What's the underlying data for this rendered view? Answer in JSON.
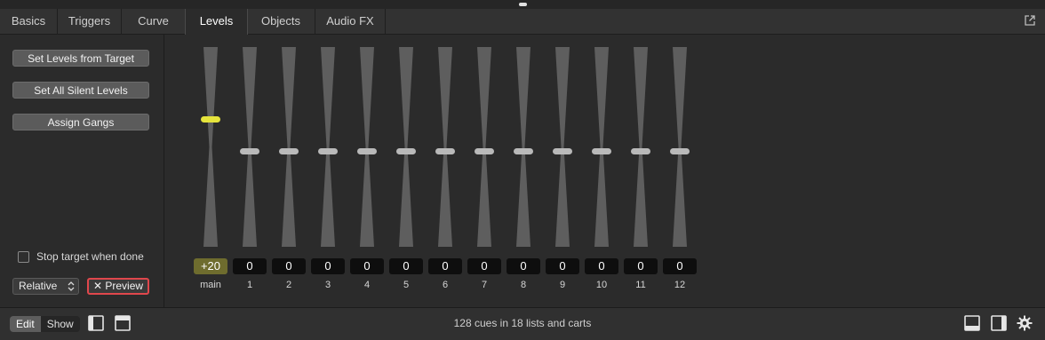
{
  "tabs": [
    {
      "label": "Basics",
      "active": false
    },
    {
      "label": "Triggers",
      "active": false
    },
    {
      "label": "Curve",
      "active": false
    },
    {
      "label": "Levels",
      "active": true
    },
    {
      "label": "Objects",
      "active": false
    },
    {
      "label": "Audio FX",
      "active": false
    }
  ],
  "left_panel": {
    "set_from_target": "Set Levels from Target",
    "set_silent": "Set All Silent Levels",
    "assign_gangs": "Assign Gangs",
    "stop_target_label": "Stop target when done",
    "stop_target_checked": false,
    "mode_select": "Relative",
    "preview_label": "Preview"
  },
  "faders": [
    {
      "label": "main",
      "value": "+20",
      "level": 0.36
    },
    {
      "label": "1",
      "value": "0",
      "level": 0.52
    },
    {
      "label": "2",
      "value": "0",
      "level": 0.52
    },
    {
      "label": "3",
      "value": "0",
      "level": 0.52
    },
    {
      "label": "4",
      "value": "0",
      "level": 0.52
    },
    {
      "label": "5",
      "value": "0",
      "level": 0.52
    },
    {
      "label": "6",
      "value": "0",
      "level": 0.52
    },
    {
      "label": "7",
      "value": "0",
      "level": 0.52
    },
    {
      "label": "8",
      "value": "0",
      "level": 0.52
    },
    {
      "label": "9",
      "value": "0",
      "level": 0.52
    },
    {
      "label": "10",
      "value": "0",
      "level": 0.52
    },
    {
      "label": "11",
      "value": "0",
      "level": 0.52
    },
    {
      "label": "12",
      "value": "0",
      "level": 0.52
    }
  ],
  "status_bar": {
    "edit_label": "Edit",
    "show_label": "Show",
    "summary": "128 cues in 18 lists and carts"
  },
  "colors": {
    "main_thumb": "#e6e43c",
    "main_value_bg": "#6e6c2e",
    "preview_border": "#e0474c"
  }
}
